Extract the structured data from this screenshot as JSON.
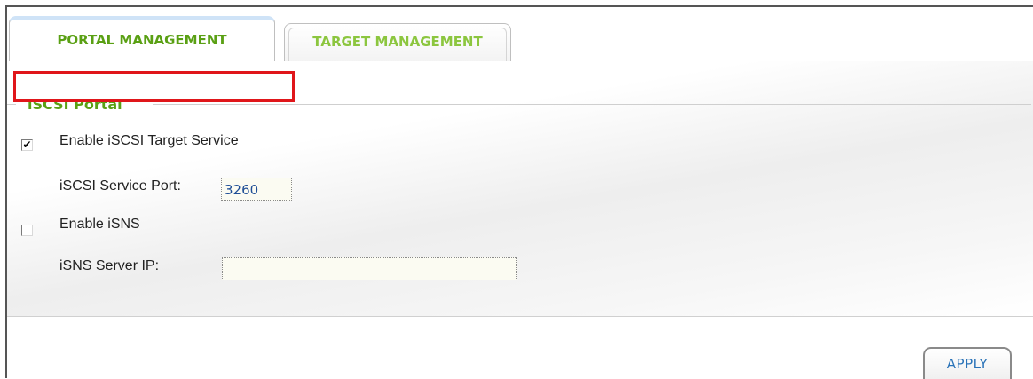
{
  "tabs": [
    {
      "label": "PORTAL MANAGEMENT",
      "active": true
    },
    {
      "label": "TARGET MANAGEMENT",
      "active": false
    }
  ],
  "section": {
    "legend": "iSCSI Portal"
  },
  "fields": {
    "enable_target_service": {
      "label": "Enable iSCSI Target Service",
      "checked": true
    },
    "service_port": {
      "label": "iSCSI Service Port:",
      "value": "3260"
    },
    "enable_isns": {
      "label": "Enable iSNS",
      "checked": false
    },
    "isns_server_ip": {
      "label": "iSNS Server IP:",
      "value": ""
    }
  },
  "actions": {
    "apply_label": "APPLY"
  },
  "colors": {
    "tab_text": "#5aa014",
    "highlight": "#e0161a",
    "apply_text": "#2a73b8"
  }
}
